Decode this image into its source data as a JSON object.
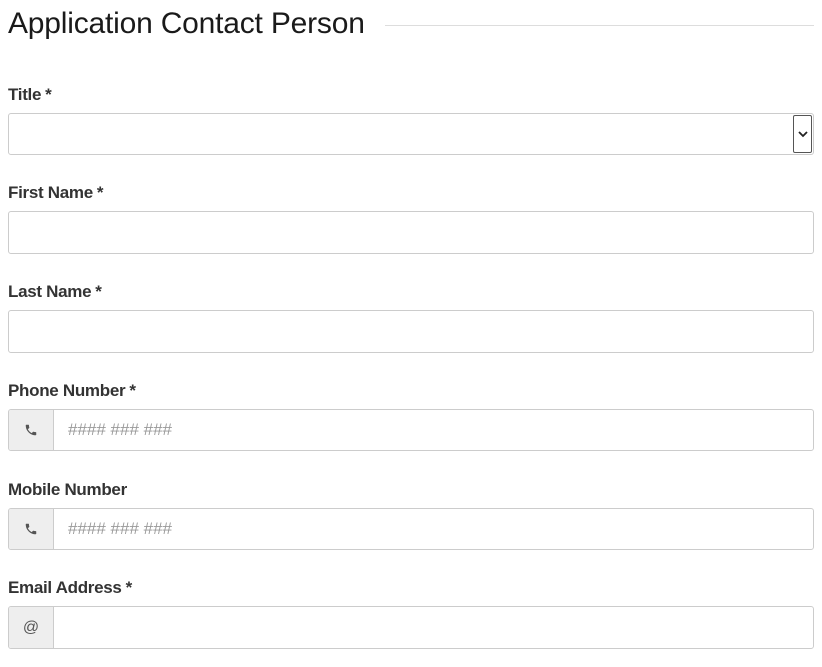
{
  "section": {
    "title": "Application Contact Person"
  },
  "fields": {
    "title": {
      "label": "Title",
      "required_mark": "*",
      "value": ""
    },
    "first_name": {
      "label": "First Name",
      "required_mark": "*",
      "value": ""
    },
    "last_name": {
      "label": "Last Name",
      "required_mark": "*",
      "value": ""
    },
    "phone_number": {
      "label": "Phone Number",
      "required_mark": "*",
      "placeholder": "#### ### ###",
      "icon": "phone-icon"
    },
    "mobile_number": {
      "label": "Mobile Number",
      "placeholder": "#### ### ###",
      "icon": "phone-icon"
    },
    "email_address": {
      "label": "Email Address",
      "required_mark": "*",
      "addon_text": "@",
      "value": ""
    }
  }
}
